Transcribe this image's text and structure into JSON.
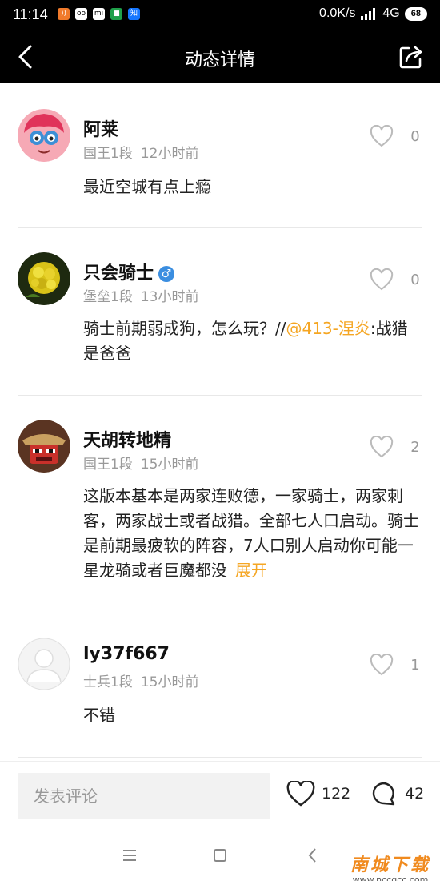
{
  "status_bar": {
    "time": "11:14",
    "network_speed": "0.0K/s",
    "network_type": "4G",
    "battery": "68"
  },
  "header": {
    "title": "动态详情",
    "back_icon": "chevron-left-icon",
    "share_icon": "share-icon"
  },
  "comments": [
    {
      "username": "阿莱",
      "rank": "国王1段",
      "time_ago": "12小时前",
      "likes": "0",
      "text": "最近空城有点上瘾",
      "avatar": "cartoon-avatar"
    },
    {
      "username": "只会骑士",
      "gender": "♂",
      "rank": "堡垒1段",
      "time_ago": "13小时前",
      "likes": "0",
      "text_before": "骑士前期弱成狗，怎么玩？//",
      "mention": "@413-涅炎",
      "text_after": ":战猎是爸爸",
      "avatar": "flower-avatar"
    },
    {
      "username": "天胡转地精",
      "rank": "国王1段",
      "time_ago": "15小时前",
      "likes": "2",
      "text": "这版本基本是两家连败德，一家骑士，两家刺客，两家战士或者战猎。全部七人口启动。骑士是前期最疲软的阵容，7人口别人启动你可能一星龙骑或者巨魔都没",
      "expand": "展开",
      "avatar": "character-avatar"
    },
    {
      "username": "ly37f667",
      "rank": "士兵1段",
      "time_ago": "15小时前",
      "likes": "1",
      "text": "不错",
      "avatar": "default-avatar"
    }
  ],
  "bottom_bar": {
    "placeholder": "发表评论",
    "like_count": "122",
    "comment_count": "42"
  },
  "watermark": {
    "main": "南城下载",
    "sub": "www.nccgcc.com"
  }
}
